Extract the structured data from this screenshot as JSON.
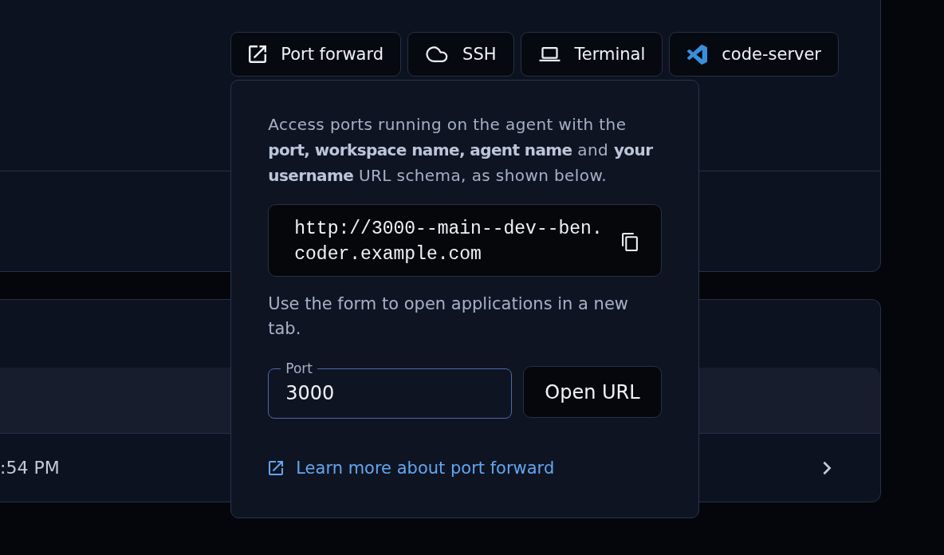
{
  "toolbar": {
    "buttons": [
      {
        "label": "Port forward",
        "kind": "external"
      },
      {
        "label": "SSH",
        "kind": "cloud"
      },
      {
        "label": "Terminal",
        "kind": "laptop"
      },
      {
        "label": "code-server",
        "kind": "vscode"
      }
    ]
  },
  "port_forward_popover": {
    "intro": "Access ports running on the agent with the **port, workspace name, agent name** and **your username** URL schema, as shown below.",
    "url": "http://3000--main--dev--ben.coder.example.com",
    "form_hint": "Use the form to open applications in a new tab.",
    "port_field": {
      "label": "Port",
      "value": "3000"
    },
    "open_button": "Open URL",
    "learn_more_link": "Learn more about port forward"
  },
  "table": {
    "rows": [
      {
        "column_1": ":54 PM"
      }
    ]
  }
}
